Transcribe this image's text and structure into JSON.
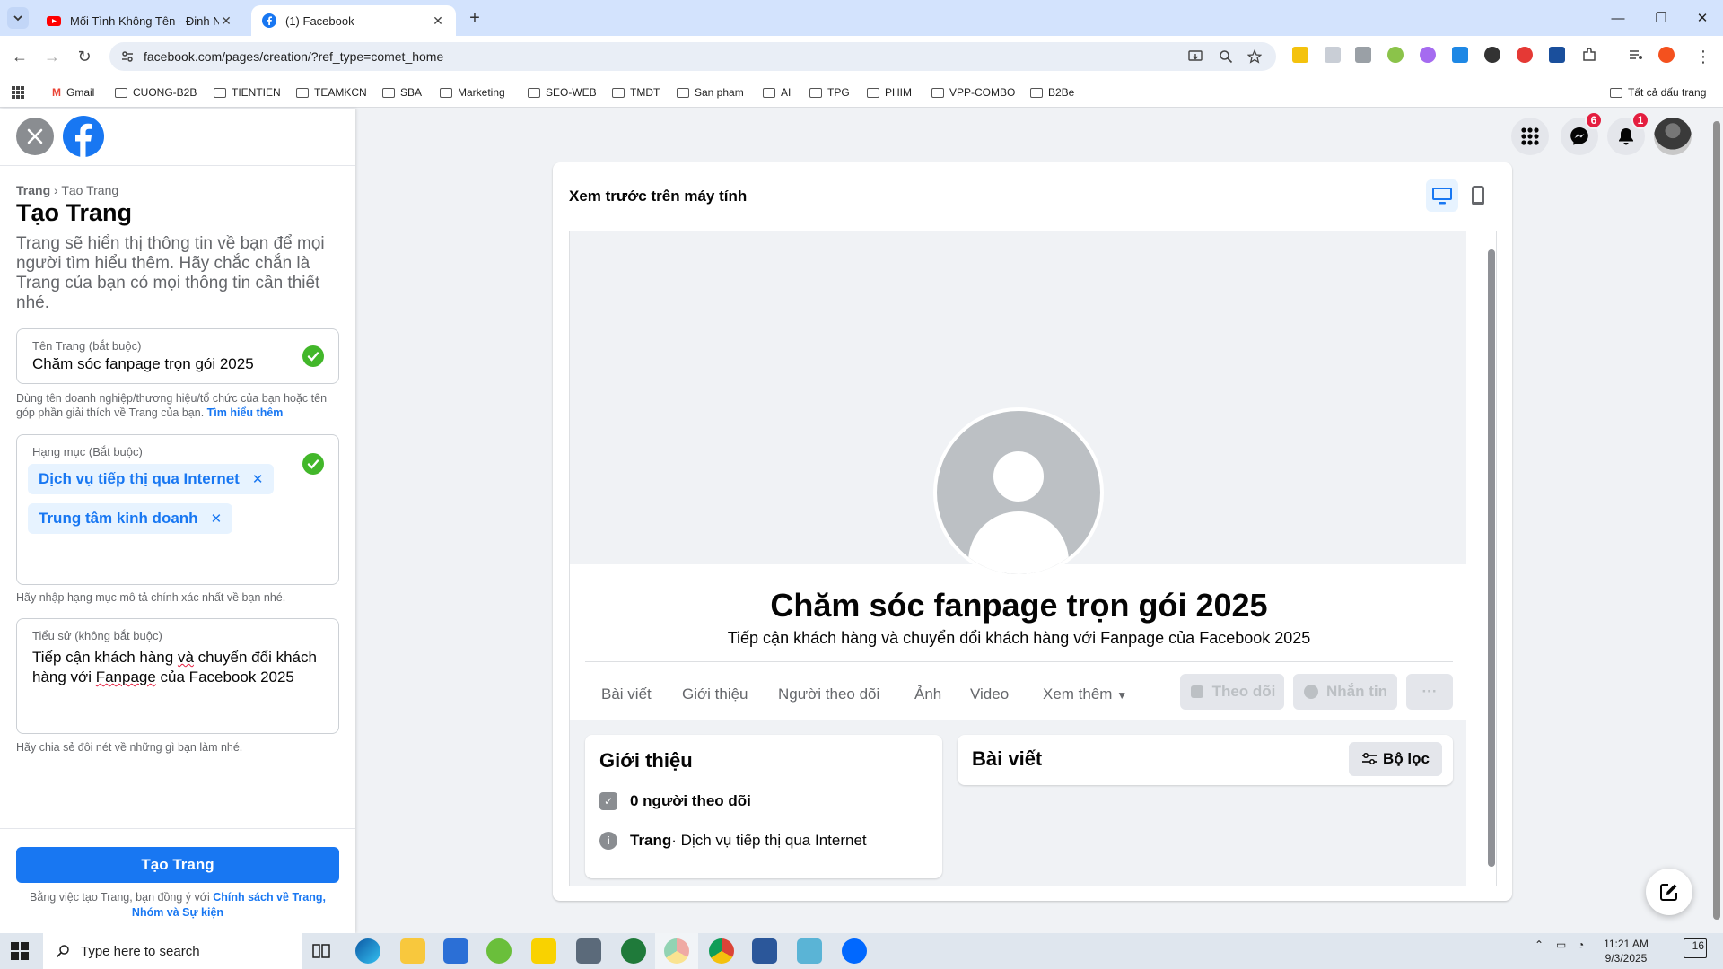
{
  "browser": {
    "tabs": [
      {
        "title": "Mối Tình Không Tên - Đinh Ng",
        "active": false,
        "favicon": "youtube-icon"
      },
      {
        "title": "(1) Facebook",
        "active": true,
        "favicon": "facebook-icon"
      }
    ],
    "url": "facebook.com/pages/creation/?ref_type=comet_home",
    "bookmarks": [
      "Gmail",
      "CUONG-B2B",
      "TIENTIEN",
      "TEAMKCN",
      "SBA",
      "Marketing",
      "SEO-WEB",
      "TMDT",
      "San pham",
      "AI",
      "TPG",
      "PHIM",
      "VPP-COMBO",
      "B2Be"
    ],
    "all_bookmarks": "Tất cả dấu trang"
  },
  "left_panel": {
    "breadcrumb_root": "Trang",
    "breadcrumb_sep": "›",
    "breadcrumb_current": "Tạo Trang",
    "title": "Tạo Trang",
    "intro": "Trang sẽ hiển thị thông tin về bạn để mọi người tìm hiểu thêm. Hãy chắc chắn là Trang của bạn có mọi thông tin cần thiết nhé.",
    "name_field": {
      "label": "Tên Trang (bắt buộc)",
      "value": "Chăm sóc fanpage trọn gói 2025",
      "helper": "Dùng tên doanh nghiệp/thương hiệu/tổ chức của bạn hoặc tên góp phần giải thích về Trang của bạn.",
      "helper_link": "Tìm hiểu thêm"
    },
    "category_field": {
      "label": "Hạng mục (Bắt buộc)",
      "chips": [
        "Dịch vụ tiếp thị qua Internet",
        "Trung tâm kinh doanh"
      ],
      "helper": "Hãy nhập hạng mục mô tả chính xác nhất về bạn nhé."
    },
    "bio_field": {
      "label": "Tiểu sử (không bắt buộc)",
      "value_part1": "Tiếp cận khách hàng ",
      "value_misspelled1": "và",
      "value_part2": " chuyển đổi khách hàng với ",
      "value_misspelled2": "Fanpage",
      "value_part3": " của Facebook 2025",
      "helper": "Hãy chia sẻ đôi nét về những gì bạn làm nhé."
    },
    "create_button": "Tạo Trang",
    "terms_prefix": "Bằng việc tạo Trang, bạn đồng ý với ",
    "terms_link": "Chính sách về Trang, Nhóm và Sự kiện"
  },
  "header_icons": {
    "messenger_badge": "6",
    "notifications_badge": "1"
  },
  "preview": {
    "title": "Xem trước trên máy tính",
    "page_name": "Chăm sóc fanpage trọn gói 2025",
    "page_bio": "Tiếp cận khách hàng và chuyển đổi khách hàng với Fanpage của Facebook 2025",
    "tabs": [
      "Bài viết",
      "Giới thiệu",
      "Người theo dõi",
      "Ảnh",
      "Video",
      "Xem thêm"
    ],
    "follow_button": "Theo dõi",
    "message_button": "Nhắn tin",
    "more_button": "···",
    "intro_card": {
      "title": "Giới thiệu",
      "followers": "0 người theo dõi",
      "type_bold": "Trang",
      "type_rest": " · Dịch vụ tiếp thị qua Internet"
    },
    "posts_card": {
      "title": "Bài viết",
      "filter": "Bộ lọc"
    }
  },
  "taskbar": {
    "search_placeholder": "Type here to search",
    "time": "11:21 AM",
    "date": "9/3/2025",
    "notif_count": "16"
  },
  "colors": {
    "facebook_blue": "#1877f2",
    "success_green": "#42b72a",
    "badge_red": "#e41e3f"
  }
}
